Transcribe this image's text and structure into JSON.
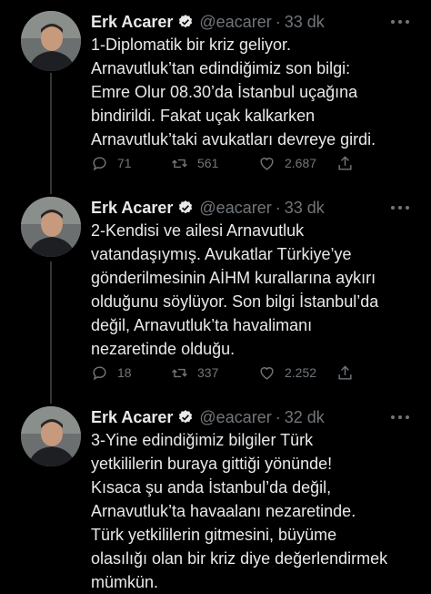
{
  "tweets": [
    {
      "name": "Erk Acarer",
      "handle": "@eacarer",
      "separator": "·",
      "time": "33 dk",
      "text": "1-Diplomatik bir kriz geliyor.\nArnavutluk’tan edindiğimiz son bilgi:\nEmre Olur 08.30’da İstanbul uçağına\nbindirildi. Fakat uçak kalkarken\nArnavutluk’taki avukatları devreye girdi.",
      "replies": "71",
      "retweets": "561",
      "likes": "2.687"
    },
    {
      "name": "Erk Acarer",
      "handle": "@eacarer",
      "separator": "·",
      "time": "33 dk",
      "text": "2-Kendisi ve ailesi Arnavutluk\nvatandaşıymış. Avukatlar Türkiye’ye\ngönderilmesinin AİHM kurallarına aykırı\nolduğunu söylüyor. Son bilgi İstanbul’da\ndeğil, Arnavutluk’ta havalimanı\nnezaretinde olduğu.",
      "replies": "18",
      "retweets": "337",
      "likes": "2.252"
    },
    {
      "name": "Erk Acarer",
      "handle": "@eacarer",
      "separator": "·",
      "time": "32 dk",
      "text": "3-Yine edindiğimiz bilgiler Türk\nyetkililerin buraya gittiği yönünde!\nKısaca şu anda İstanbul’da değil,\nArnavutluk’ta havaalanı nezaretinde.\nTürk yetkililerin gitmesini, büyüme\nolasılığı olan bir kriz diye değerlendirmek\nmümkün."
    }
  ],
  "colors": {
    "background": "#000000",
    "text": "#e7e9ea",
    "muted": "#71767b",
    "verified": "#1d9bf0",
    "thread_line": "#333639"
  },
  "icons": [
    "verified-badge-icon",
    "more-icon",
    "reply-icon",
    "retweet-icon",
    "like-icon",
    "share-icon"
  ]
}
